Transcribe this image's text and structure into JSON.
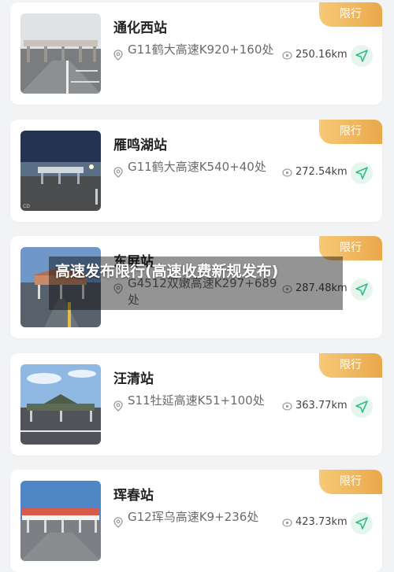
{
  "stations": [
    {
      "name": "通化西站",
      "badge": "限行",
      "address": "G11鹤大高速K920+160处",
      "distance": "250.16km"
    },
    {
      "name": "雁鸣湖站",
      "badge": "限行",
      "address": "G11鹤大高速K540+40处",
      "distance": "272.54km"
    },
    {
      "name": "东屏站",
      "badge": "限行",
      "address": "G4512双嫩高速K297+689处",
      "distance": "287.48km"
    },
    {
      "name": "汪清站",
      "badge": "限行",
      "address": "S11牡延高速K51+100处",
      "distance": "363.77km"
    },
    {
      "name": "珲春站",
      "badge": "限行",
      "address": "G12珲乌高速K9+236处",
      "distance": "423.73km"
    }
  ],
  "overlay": {
    "title": "高速发布限行(高速收费新规发布)"
  },
  "icons": {
    "location": "location-pin-icon",
    "distance": "distance-icon",
    "navigate": "navigate-arrow-icon"
  },
  "colors": {
    "badge_start": "#f7c978",
    "badge_end": "#e9a84a",
    "nav_bg": "#e6f6ef",
    "nav_arrow": "#2fbf86"
  }
}
